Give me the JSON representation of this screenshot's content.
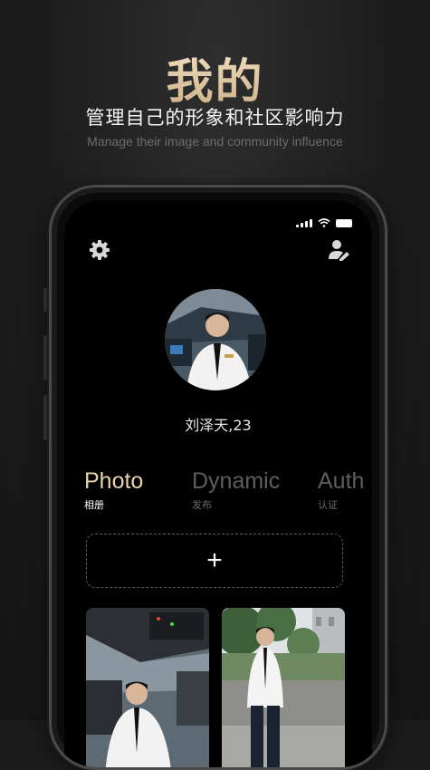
{
  "hero": {
    "title": "我的",
    "subtitle_cn": "管理自己的形象和社区影响力",
    "subtitle_en": "Manage their image and community influence"
  },
  "profile": {
    "name_age": "刘泽天,23"
  },
  "tabs": [
    {
      "en": "Photo",
      "cn": "相册",
      "active": true
    },
    {
      "en": "Dynamic",
      "cn": "发布",
      "active": false
    },
    {
      "en": "Auth",
      "cn": "认证",
      "active": false
    }
  ],
  "add_label": "+",
  "icons": {
    "settings": "gear-icon",
    "profile_edit": "user-edit-icon",
    "signal": "signal-icon",
    "wifi": "wifi-icon",
    "battery": "battery-icon"
  },
  "colors": {
    "accent_gold": "#e9d2ae",
    "background": "#1d1d1d"
  }
}
